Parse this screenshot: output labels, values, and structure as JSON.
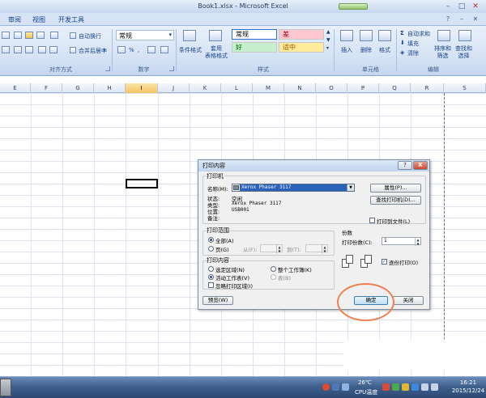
{
  "window": {
    "title": "Book1.xlsx - Microsoft Excel"
  },
  "tabs": [
    "审阅",
    "视图",
    "开发工具"
  ],
  "ribbon": {
    "align": {
      "wrap_label": "自动换行",
      "merge_label": "合并后居中",
      "group_label": "对齐方式"
    },
    "number": {
      "format_value": "常规",
      "group_label": "数字"
    },
    "styles": {
      "conditional_label": "条件格式",
      "table_format_label": "套用\n表格格式",
      "normal": "常规",
      "bad": "差",
      "good": "好",
      "neutral": "适中",
      "group_label": "样式",
      "colors": {
        "bad_bg": "#ffc7ce",
        "bad_fg": "#9c0006",
        "good_bg": "#c6efce",
        "good_fg": "#006100",
        "neutral_bg": "#ffeb9c",
        "neutral_fg": "#9c5700"
      }
    },
    "cells": {
      "insert_label": "插入",
      "delete_label": "删除",
      "format_label": "格式",
      "group_label": "单元格"
    },
    "editing": {
      "autosum_label": "自动求和",
      "fill_label": "填充",
      "clear_label": "清除",
      "sort_label": "排序和\n筛选",
      "find_label": "查找和\n选择",
      "group_label": "编辑"
    }
  },
  "columns": [
    "E",
    "F",
    "G",
    "H",
    "I",
    "J",
    "K",
    "L",
    "M",
    "N",
    "O",
    "P",
    "Q",
    "R",
    "S"
  ],
  "selected_column": "I",
  "dialog": {
    "title": "打印内容",
    "help_icon": "?",
    "close_icon": "X",
    "printer": {
      "legend": "打印机",
      "name_label": "名称(M):",
      "name_value": "Xerox Phaser 3117",
      "status_label": "状态:",
      "status_value": "空闲",
      "type_label": "类型:",
      "type_value": "Xerox Phaser 3117",
      "where_label": "位置:",
      "where_value": "USB001",
      "comment_label": "备注:",
      "properties_button": "属性(P)...",
      "find_button": "查找打印机(D)...",
      "print_to_file": "打印到文件(L)"
    },
    "range": {
      "legend": "打印范围",
      "all": "全部(A)",
      "pages": "页(G)",
      "from": "从(F):",
      "to": "到(T):"
    },
    "what": {
      "legend": "打印内容",
      "selection": "选定区域(N)",
      "workbook": "整个工作簿(K)",
      "active_sheets": "活动工作表(V)",
      "table": "表(B)",
      "ignore_area": "忽略打印区域(I)"
    },
    "copies": {
      "legend": "份数",
      "number_label": "打印份数(C):",
      "number_value": "1",
      "collate": "逐份打印(O)"
    },
    "preview_button": "预览(W)",
    "ok_button": "确定",
    "cancel_button": "关闭",
    "annotation_color": "#ef7f4d"
  },
  "taskbar": {
    "cpu_value": "26℃",
    "cpu_label": "CPU温度",
    "time": "16:21",
    "date": "2015/12/24"
  }
}
